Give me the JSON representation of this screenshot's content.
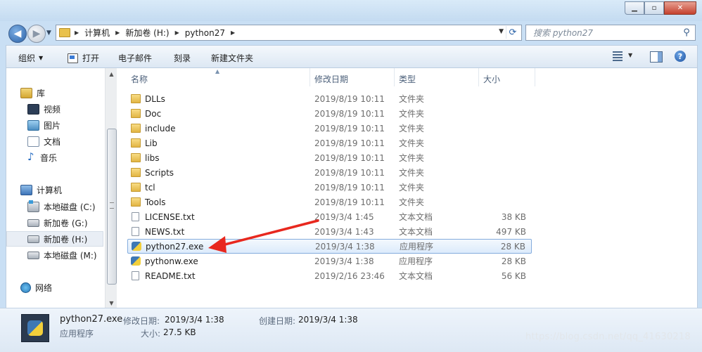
{
  "window": {
    "minimize_label": "▁",
    "maximize_label": "▫",
    "close_label": "✕"
  },
  "address": {
    "crumbs": [
      "计算机",
      "新加卷 (H:)",
      "python27"
    ]
  },
  "search": {
    "placeholder": "搜索 python27"
  },
  "toolbar": {
    "organize": "组织",
    "open": "打开",
    "email": "电子邮件",
    "burn": "刻录",
    "new_folder": "新建文件夹"
  },
  "sidebar": {
    "libraries": "库",
    "videos": "视频",
    "pictures": "图片",
    "documents": "文档",
    "music": "音乐",
    "computer": "计算机",
    "drive_c": "本地磁盘 (C:)",
    "drive_g": "新加卷 (G:)",
    "drive_h": "新加卷 (H:)",
    "drive_m": "本地磁盘 (M:)",
    "network": "网络"
  },
  "columns": {
    "name": "名称",
    "modified": "修改日期",
    "type": "类型",
    "size": "大小"
  },
  "files": [
    {
      "name": "DLLs",
      "date": "2019/8/19 10:11",
      "type": "文件夹",
      "size": "",
      "kind": "folder"
    },
    {
      "name": "Doc",
      "date": "2019/8/19 10:11",
      "type": "文件夹",
      "size": "",
      "kind": "folder"
    },
    {
      "name": "include",
      "date": "2019/8/19 10:11",
      "type": "文件夹",
      "size": "",
      "kind": "folder"
    },
    {
      "name": "Lib",
      "date": "2019/8/19 10:11",
      "type": "文件夹",
      "size": "",
      "kind": "folder"
    },
    {
      "name": "libs",
      "date": "2019/8/19 10:11",
      "type": "文件夹",
      "size": "",
      "kind": "folder"
    },
    {
      "name": "Scripts",
      "date": "2019/8/19 10:11",
      "type": "文件夹",
      "size": "",
      "kind": "folder"
    },
    {
      "name": "tcl",
      "date": "2019/8/19 10:11",
      "type": "文件夹",
      "size": "",
      "kind": "folder"
    },
    {
      "name": "Tools",
      "date": "2019/8/19 10:11",
      "type": "文件夹",
      "size": "",
      "kind": "folder"
    },
    {
      "name": "LICENSE.txt",
      "date": "2019/3/4 1:45",
      "type": "文本文档",
      "size": "38 KB",
      "kind": "txt"
    },
    {
      "name": "NEWS.txt",
      "date": "2019/3/4 1:43",
      "type": "文本文档",
      "size": "497 KB",
      "kind": "txt"
    },
    {
      "name": "python27.exe",
      "date": "2019/3/4 1:38",
      "type": "应用程序",
      "size": "28 KB",
      "kind": "py"
    },
    {
      "name": "pythonw.exe",
      "date": "2019/3/4 1:38",
      "type": "应用程序",
      "size": "28 KB",
      "kind": "py"
    },
    {
      "name": "README.txt",
      "date": "2019/2/16 23:46",
      "type": "文本文档",
      "size": "56 KB",
      "kind": "txt"
    }
  ],
  "selected_index": 10,
  "details": {
    "filename": "python27.exe",
    "modified_label": "修改日期:",
    "modified_value": "2019/3/4 1:38",
    "created_label": "创建日期:",
    "created_value": "2019/3/4 1:38",
    "type": "应用程序",
    "size_label": "大小:",
    "size_value": "27.5 KB"
  },
  "watermark": "https://blog.csdn.net/qq_41630218",
  "colors": {
    "arrow": "#e8281e",
    "selection_border": "#84acdd"
  }
}
